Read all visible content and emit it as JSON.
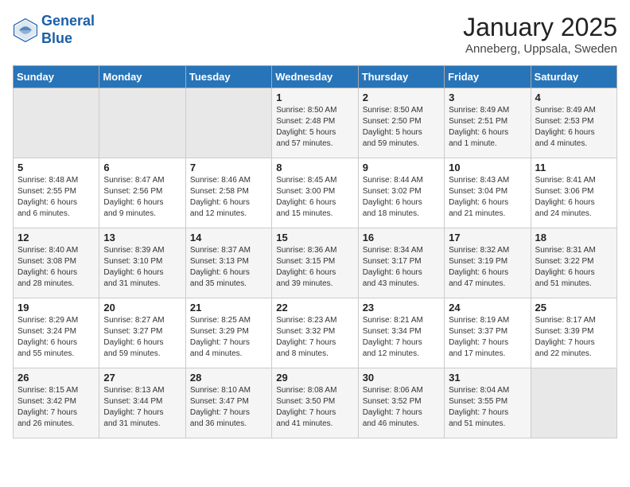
{
  "header": {
    "logo_line1": "General",
    "logo_line2": "Blue",
    "title": "January 2025",
    "subtitle": "Anneberg, Uppsala, Sweden"
  },
  "days_of_week": [
    "Sunday",
    "Monday",
    "Tuesday",
    "Wednesday",
    "Thursday",
    "Friday",
    "Saturday"
  ],
  "weeks": [
    [
      {
        "day": "",
        "info": ""
      },
      {
        "day": "",
        "info": ""
      },
      {
        "day": "",
        "info": ""
      },
      {
        "day": "1",
        "info": "Sunrise: 8:50 AM\nSunset: 2:48 PM\nDaylight: 5 hours\nand 57 minutes."
      },
      {
        "day": "2",
        "info": "Sunrise: 8:50 AM\nSunset: 2:50 PM\nDaylight: 5 hours\nand 59 minutes."
      },
      {
        "day": "3",
        "info": "Sunrise: 8:49 AM\nSunset: 2:51 PM\nDaylight: 6 hours\nand 1 minute."
      },
      {
        "day": "4",
        "info": "Sunrise: 8:49 AM\nSunset: 2:53 PM\nDaylight: 6 hours\nand 4 minutes."
      }
    ],
    [
      {
        "day": "5",
        "info": "Sunrise: 8:48 AM\nSunset: 2:55 PM\nDaylight: 6 hours\nand 6 minutes."
      },
      {
        "day": "6",
        "info": "Sunrise: 8:47 AM\nSunset: 2:56 PM\nDaylight: 6 hours\nand 9 minutes."
      },
      {
        "day": "7",
        "info": "Sunrise: 8:46 AM\nSunset: 2:58 PM\nDaylight: 6 hours\nand 12 minutes."
      },
      {
        "day": "8",
        "info": "Sunrise: 8:45 AM\nSunset: 3:00 PM\nDaylight: 6 hours\nand 15 minutes."
      },
      {
        "day": "9",
        "info": "Sunrise: 8:44 AM\nSunset: 3:02 PM\nDaylight: 6 hours\nand 18 minutes."
      },
      {
        "day": "10",
        "info": "Sunrise: 8:43 AM\nSunset: 3:04 PM\nDaylight: 6 hours\nand 21 minutes."
      },
      {
        "day": "11",
        "info": "Sunrise: 8:41 AM\nSunset: 3:06 PM\nDaylight: 6 hours\nand 24 minutes."
      }
    ],
    [
      {
        "day": "12",
        "info": "Sunrise: 8:40 AM\nSunset: 3:08 PM\nDaylight: 6 hours\nand 28 minutes."
      },
      {
        "day": "13",
        "info": "Sunrise: 8:39 AM\nSunset: 3:10 PM\nDaylight: 6 hours\nand 31 minutes."
      },
      {
        "day": "14",
        "info": "Sunrise: 8:37 AM\nSunset: 3:13 PM\nDaylight: 6 hours\nand 35 minutes."
      },
      {
        "day": "15",
        "info": "Sunrise: 8:36 AM\nSunset: 3:15 PM\nDaylight: 6 hours\nand 39 minutes."
      },
      {
        "day": "16",
        "info": "Sunrise: 8:34 AM\nSunset: 3:17 PM\nDaylight: 6 hours\nand 43 minutes."
      },
      {
        "day": "17",
        "info": "Sunrise: 8:32 AM\nSunset: 3:19 PM\nDaylight: 6 hours\nand 47 minutes."
      },
      {
        "day": "18",
        "info": "Sunrise: 8:31 AM\nSunset: 3:22 PM\nDaylight: 6 hours\nand 51 minutes."
      }
    ],
    [
      {
        "day": "19",
        "info": "Sunrise: 8:29 AM\nSunset: 3:24 PM\nDaylight: 6 hours\nand 55 minutes."
      },
      {
        "day": "20",
        "info": "Sunrise: 8:27 AM\nSunset: 3:27 PM\nDaylight: 6 hours\nand 59 minutes."
      },
      {
        "day": "21",
        "info": "Sunrise: 8:25 AM\nSunset: 3:29 PM\nDaylight: 7 hours\nand 4 minutes."
      },
      {
        "day": "22",
        "info": "Sunrise: 8:23 AM\nSunset: 3:32 PM\nDaylight: 7 hours\nand 8 minutes."
      },
      {
        "day": "23",
        "info": "Sunrise: 8:21 AM\nSunset: 3:34 PM\nDaylight: 7 hours\nand 12 minutes."
      },
      {
        "day": "24",
        "info": "Sunrise: 8:19 AM\nSunset: 3:37 PM\nDaylight: 7 hours\nand 17 minutes."
      },
      {
        "day": "25",
        "info": "Sunrise: 8:17 AM\nSunset: 3:39 PM\nDaylight: 7 hours\nand 22 minutes."
      }
    ],
    [
      {
        "day": "26",
        "info": "Sunrise: 8:15 AM\nSunset: 3:42 PM\nDaylight: 7 hours\nand 26 minutes."
      },
      {
        "day": "27",
        "info": "Sunrise: 8:13 AM\nSunset: 3:44 PM\nDaylight: 7 hours\nand 31 minutes."
      },
      {
        "day": "28",
        "info": "Sunrise: 8:10 AM\nSunset: 3:47 PM\nDaylight: 7 hours\nand 36 minutes."
      },
      {
        "day": "29",
        "info": "Sunrise: 8:08 AM\nSunset: 3:50 PM\nDaylight: 7 hours\nand 41 minutes."
      },
      {
        "day": "30",
        "info": "Sunrise: 8:06 AM\nSunset: 3:52 PM\nDaylight: 7 hours\nand 46 minutes."
      },
      {
        "day": "31",
        "info": "Sunrise: 8:04 AM\nSunset: 3:55 PM\nDaylight: 7 hours\nand 51 minutes."
      },
      {
        "day": "",
        "info": ""
      }
    ]
  ]
}
